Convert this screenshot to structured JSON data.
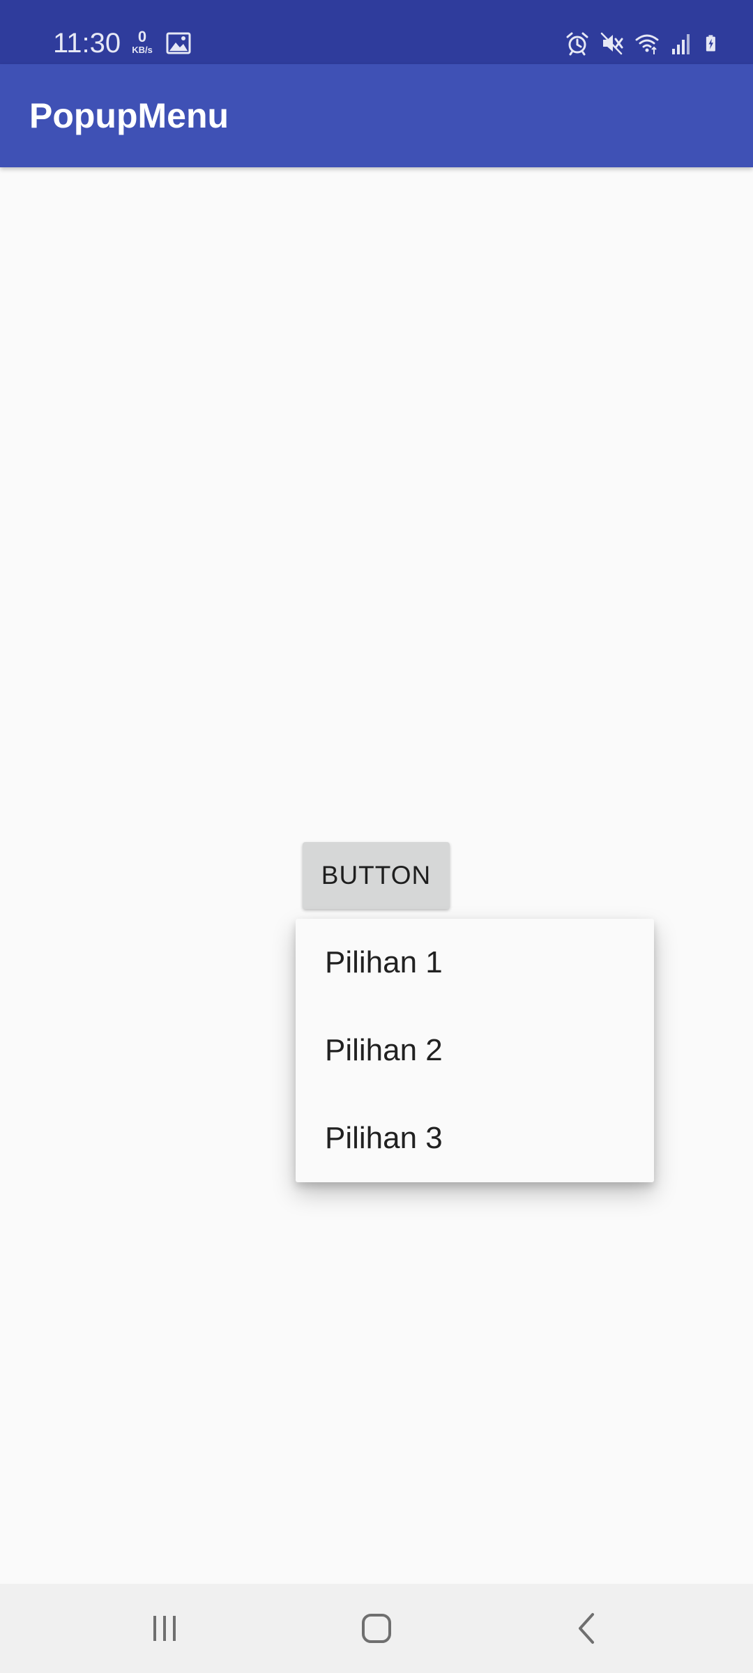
{
  "status_bar": {
    "time": "11:30",
    "net_speed_value": "0",
    "net_speed_unit": "KB/s",
    "icons": [
      "gallery-icon",
      "alarm-icon",
      "mute-icon",
      "wifi-icon",
      "signal-icon",
      "battery-charging-icon"
    ]
  },
  "app_bar": {
    "title": "PopupMenu",
    "color": "#3f51b5",
    "status_color": "#2f3c9c"
  },
  "main": {
    "button_label": "BUTTON"
  },
  "popup_menu": {
    "items": [
      {
        "label": "Pilihan 1"
      },
      {
        "label": "Pilihan 2"
      },
      {
        "label": "Pilihan 3"
      }
    ]
  },
  "nav_bar": {
    "icons": [
      "recents-icon",
      "home-icon",
      "back-icon"
    ]
  }
}
